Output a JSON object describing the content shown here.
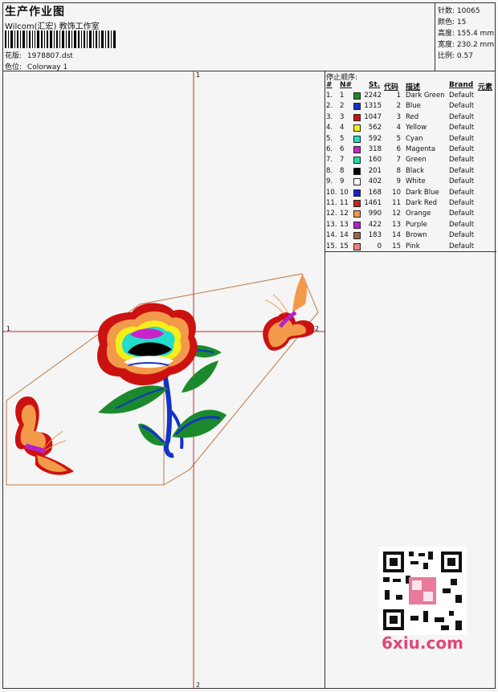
{
  "header": {
    "title": "生产作业图",
    "subtitle": "Wilcom(汇宏) 教饰工作室",
    "pattern_label": "花版:",
    "pattern_value": "1978807.dst",
    "colorway_label": "色位:",
    "colorway_value": "Colorway 1"
  },
  "stats": [
    {
      "label": "针数:",
      "value": "10065"
    },
    {
      "label": "颜色:",
      "value": "15"
    },
    {
      "label": "高度:",
      "value": "155.4 mm"
    },
    {
      "label": "宽度:",
      "value": "230.2 mm"
    },
    {
      "label": "比例:",
      "value": "0.57"
    }
  ],
  "stop_sequence": {
    "title": "停止顺序:",
    "headers": {
      "hash": "#",
      "num": "N#",
      "st": "St.",
      "code": "代码",
      "desc": "描述",
      "brand": "Brand",
      "element": "元素"
    },
    "rows": [
      {
        "idx": "1.",
        "n": "1",
        "color": "#1b8a2c",
        "st": "2242",
        "code": "1",
        "desc": "Dark Green",
        "brand": "Default"
      },
      {
        "idx": "2.",
        "n": "2",
        "color": "#1133cc",
        "st": "1315",
        "code": "2",
        "desc": "Blue",
        "brand": "Default"
      },
      {
        "idx": "3.",
        "n": "3",
        "color": "#cc1111",
        "st": "1047",
        "code": "3",
        "desc": "Red",
        "brand": "Default"
      },
      {
        "idx": "4.",
        "n": "4",
        "color": "#f4ef1a",
        "st": "562",
        "code": "4",
        "desc": "Yellow",
        "brand": "Default"
      },
      {
        "idx": "5.",
        "n": "5",
        "color": "#22ddcc",
        "st": "592",
        "code": "5",
        "desc": "Cyan",
        "brand": "Default"
      },
      {
        "idx": "6.",
        "n": "6",
        "color": "#cc22cc",
        "st": "318",
        "code": "6",
        "desc": "Magenta",
        "brand": "Default"
      },
      {
        "idx": "7.",
        "n": "7",
        "color": "#22ddaa",
        "st": "160",
        "code": "7",
        "desc": "Green",
        "brand": "Default"
      },
      {
        "idx": "8.",
        "n": "8",
        "color": "#000000",
        "st": "201",
        "code": "8",
        "desc": "Black",
        "brand": "Default"
      },
      {
        "idx": "9.",
        "n": "9",
        "color": "#ffffff",
        "st": "402",
        "code": "9",
        "desc": "White",
        "brand": "Default"
      },
      {
        "idx": "10.",
        "n": "10",
        "color": "#1122cc",
        "st": "168",
        "code": "10",
        "desc": "Dark Blue",
        "brand": "Default"
      },
      {
        "idx": "11.",
        "n": "11",
        "color": "#cc2222",
        "st": "1461",
        "code": "11",
        "desc": "Dark Red",
        "brand": "Default"
      },
      {
        "idx": "12.",
        "n": "12",
        "color": "#f39a4a",
        "st": "990",
        "code": "12",
        "desc": "Orange",
        "brand": "Default"
      },
      {
        "idx": "13.",
        "n": "13",
        "color": "#b422cc",
        "st": "422",
        "code": "13",
        "desc": "Purple",
        "brand": "Default"
      },
      {
        "idx": "14.",
        "n": "14",
        "color": "#9a6a44",
        "st": "183",
        "code": "14",
        "desc": "Brown",
        "brand": "Default"
      },
      {
        "idx": "15.",
        "n": "15",
        "color": "#f08080",
        "st": "0",
        "code": "15",
        "desc": "Pink",
        "brand": "Default"
      }
    ]
  },
  "guides": {
    "v_top": "1",
    "v_bottom": "2",
    "h_left": "1",
    "h_right": "2"
  },
  "watermark": "6xiu.com",
  "colors": {
    "guide": "#cc2222",
    "outline": "#c07840",
    "watermark": "#e0467a"
  }
}
